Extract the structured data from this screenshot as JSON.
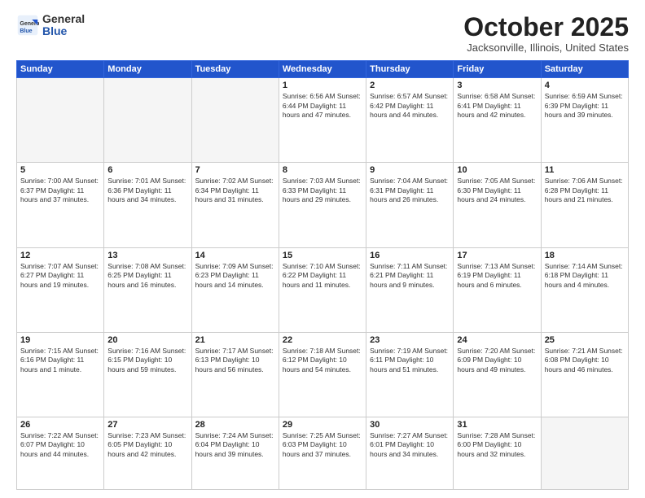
{
  "logo": {
    "general": "General",
    "blue": "Blue"
  },
  "title": "October 2025",
  "location": "Jacksonville, Illinois, United States",
  "weekdays": [
    "Sunday",
    "Monday",
    "Tuesday",
    "Wednesday",
    "Thursday",
    "Friday",
    "Saturday"
  ],
  "weeks": [
    [
      {
        "day": "",
        "info": ""
      },
      {
        "day": "",
        "info": ""
      },
      {
        "day": "",
        "info": ""
      },
      {
        "day": "1",
        "info": "Sunrise: 6:56 AM\nSunset: 6:44 PM\nDaylight: 11 hours\nand 47 minutes."
      },
      {
        "day": "2",
        "info": "Sunrise: 6:57 AM\nSunset: 6:42 PM\nDaylight: 11 hours\nand 44 minutes."
      },
      {
        "day": "3",
        "info": "Sunrise: 6:58 AM\nSunset: 6:41 PM\nDaylight: 11 hours\nand 42 minutes."
      },
      {
        "day": "4",
        "info": "Sunrise: 6:59 AM\nSunset: 6:39 PM\nDaylight: 11 hours\nand 39 minutes."
      }
    ],
    [
      {
        "day": "5",
        "info": "Sunrise: 7:00 AM\nSunset: 6:37 PM\nDaylight: 11 hours\nand 37 minutes."
      },
      {
        "day": "6",
        "info": "Sunrise: 7:01 AM\nSunset: 6:36 PM\nDaylight: 11 hours\nand 34 minutes."
      },
      {
        "day": "7",
        "info": "Sunrise: 7:02 AM\nSunset: 6:34 PM\nDaylight: 11 hours\nand 31 minutes."
      },
      {
        "day": "8",
        "info": "Sunrise: 7:03 AM\nSunset: 6:33 PM\nDaylight: 11 hours\nand 29 minutes."
      },
      {
        "day": "9",
        "info": "Sunrise: 7:04 AM\nSunset: 6:31 PM\nDaylight: 11 hours\nand 26 minutes."
      },
      {
        "day": "10",
        "info": "Sunrise: 7:05 AM\nSunset: 6:30 PM\nDaylight: 11 hours\nand 24 minutes."
      },
      {
        "day": "11",
        "info": "Sunrise: 7:06 AM\nSunset: 6:28 PM\nDaylight: 11 hours\nand 21 minutes."
      }
    ],
    [
      {
        "day": "12",
        "info": "Sunrise: 7:07 AM\nSunset: 6:27 PM\nDaylight: 11 hours\nand 19 minutes."
      },
      {
        "day": "13",
        "info": "Sunrise: 7:08 AM\nSunset: 6:25 PM\nDaylight: 11 hours\nand 16 minutes."
      },
      {
        "day": "14",
        "info": "Sunrise: 7:09 AM\nSunset: 6:23 PM\nDaylight: 11 hours\nand 14 minutes."
      },
      {
        "day": "15",
        "info": "Sunrise: 7:10 AM\nSunset: 6:22 PM\nDaylight: 11 hours\nand 11 minutes."
      },
      {
        "day": "16",
        "info": "Sunrise: 7:11 AM\nSunset: 6:21 PM\nDaylight: 11 hours\nand 9 minutes."
      },
      {
        "day": "17",
        "info": "Sunrise: 7:13 AM\nSunset: 6:19 PM\nDaylight: 11 hours\nand 6 minutes."
      },
      {
        "day": "18",
        "info": "Sunrise: 7:14 AM\nSunset: 6:18 PM\nDaylight: 11 hours\nand 4 minutes."
      }
    ],
    [
      {
        "day": "19",
        "info": "Sunrise: 7:15 AM\nSunset: 6:16 PM\nDaylight: 11 hours\nand 1 minute."
      },
      {
        "day": "20",
        "info": "Sunrise: 7:16 AM\nSunset: 6:15 PM\nDaylight: 10 hours\nand 59 minutes."
      },
      {
        "day": "21",
        "info": "Sunrise: 7:17 AM\nSunset: 6:13 PM\nDaylight: 10 hours\nand 56 minutes."
      },
      {
        "day": "22",
        "info": "Sunrise: 7:18 AM\nSunset: 6:12 PM\nDaylight: 10 hours\nand 54 minutes."
      },
      {
        "day": "23",
        "info": "Sunrise: 7:19 AM\nSunset: 6:11 PM\nDaylight: 10 hours\nand 51 minutes."
      },
      {
        "day": "24",
        "info": "Sunrise: 7:20 AM\nSunset: 6:09 PM\nDaylight: 10 hours\nand 49 minutes."
      },
      {
        "day": "25",
        "info": "Sunrise: 7:21 AM\nSunset: 6:08 PM\nDaylight: 10 hours\nand 46 minutes."
      }
    ],
    [
      {
        "day": "26",
        "info": "Sunrise: 7:22 AM\nSunset: 6:07 PM\nDaylight: 10 hours\nand 44 minutes."
      },
      {
        "day": "27",
        "info": "Sunrise: 7:23 AM\nSunset: 6:05 PM\nDaylight: 10 hours\nand 42 minutes."
      },
      {
        "day": "28",
        "info": "Sunrise: 7:24 AM\nSunset: 6:04 PM\nDaylight: 10 hours\nand 39 minutes."
      },
      {
        "day": "29",
        "info": "Sunrise: 7:25 AM\nSunset: 6:03 PM\nDaylight: 10 hours\nand 37 minutes."
      },
      {
        "day": "30",
        "info": "Sunrise: 7:27 AM\nSunset: 6:01 PM\nDaylight: 10 hours\nand 34 minutes."
      },
      {
        "day": "31",
        "info": "Sunrise: 7:28 AM\nSunset: 6:00 PM\nDaylight: 10 hours\nand 32 minutes."
      },
      {
        "day": "",
        "info": ""
      }
    ]
  ]
}
